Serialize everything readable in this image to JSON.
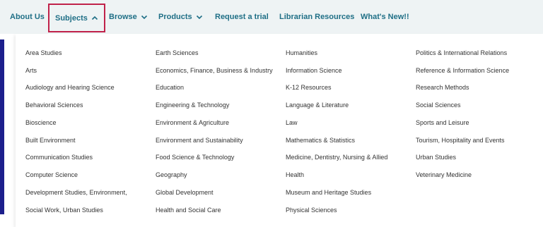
{
  "nav": {
    "about": "About Us",
    "subjects": "Subjects",
    "browse": "Browse",
    "products": "Products",
    "trial": "Request a trial",
    "librarian": "Librarian Resources",
    "whats_new": "What's New!!"
  },
  "subjects_menu": {
    "col1": [
      "Area Studies",
      "Arts",
      "Audiology and Hearing Science",
      "Behavioral Sciences",
      "Bioscience",
      "Built Environment",
      "Communication Studies",
      "Computer Science",
      "Development Studies, Environment,",
      "Social Work, Urban Studies"
    ],
    "col2": [
      "Earth Sciences",
      "Economics, Finance, Business & Industry",
      "Education",
      "Engineering & Technology",
      "Environment & Agriculture",
      "Environment and Sustainability",
      "Food Science & Technology",
      "Geography",
      "Global Development",
      "Health and Social Care"
    ],
    "col3": [
      "Humanities",
      "Information Science",
      "K-12 Resources",
      "Language & Literature",
      "Law",
      "Mathematics & Statistics",
      "Medicine, Dentistry, Nursing & Allied",
      "Health",
      "Museum and Heritage Studies",
      "Physical Sciences"
    ],
    "col4": [
      "Politics & International Relations",
      "Reference & Information Science",
      "Research Methods",
      "Social Sciences",
      "Sports and Leisure",
      "Tourism, Hospitality and Events",
      "Urban Studies",
      "Veterinary Medicine"
    ]
  },
  "colors": {
    "nav_text": "#1f6f86",
    "active_border": "#c0224a",
    "left_bar": "#1c1f8c"
  }
}
